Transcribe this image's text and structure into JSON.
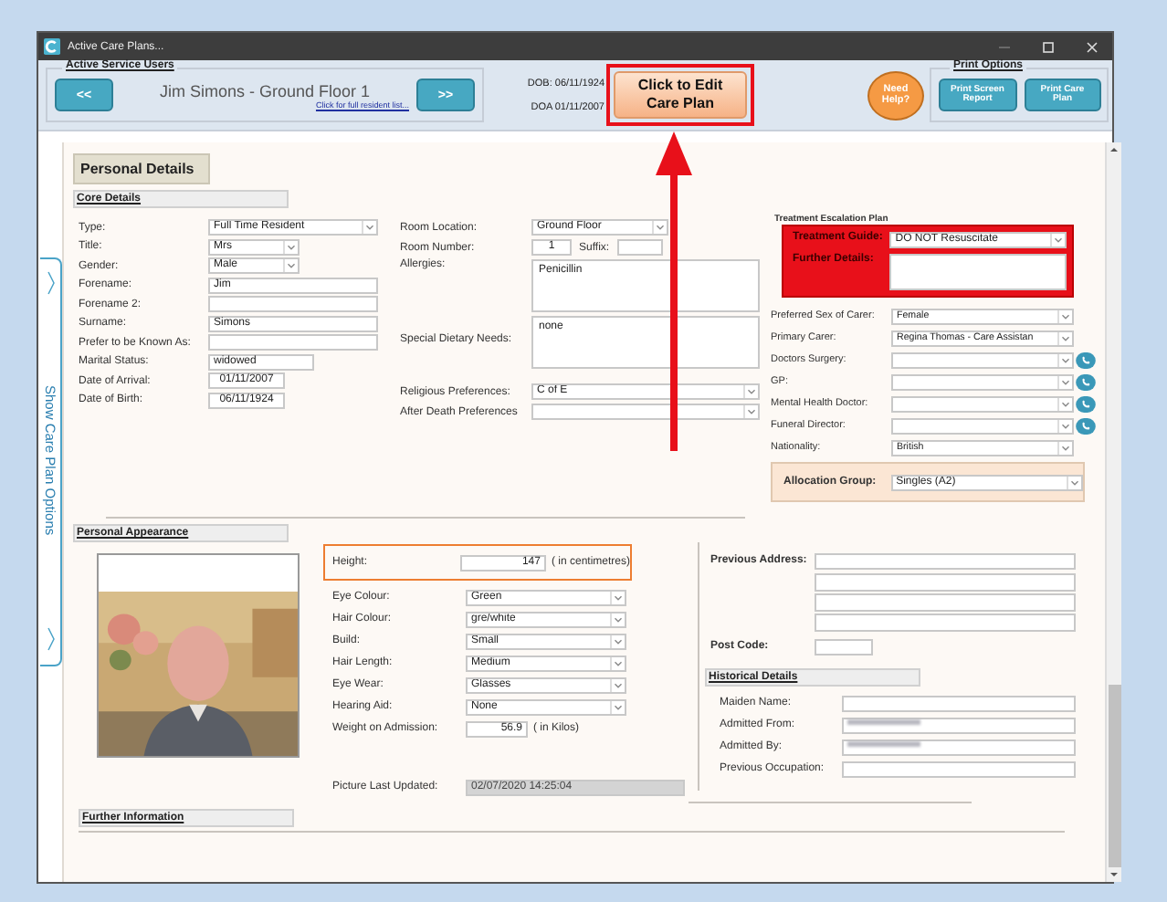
{
  "window": {
    "title": "Active Care Plans..."
  },
  "header": {
    "group_label": "Active Service Users",
    "prev_button": "<<",
    "resident_name": "Jim Simons - Ground Floor 1",
    "resident_list_link": "Click for full resident list...",
    "next_button": ">>",
    "dob": "DOB: 06/11/1924",
    "doa": "DOA 01/11/2007",
    "edit_button": "Click to Edit Care Plan",
    "help_button": "Need Help?",
    "print_group_label": "Print Options",
    "print_buttons": [
      "Print Screen Report",
      "Print Care Plan"
    ]
  },
  "side_tab": {
    "label": "Show Care Plan Options"
  },
  "page_tab": "Personal Details",
  "core_details": {
    "heading": "Core Details",
    "left_fields": [
      {
        "label": "Type:",
        "value": "Full Time Resident",
        "kind": "select"
      },
      {
        "label": "Title:",
        "value": "Mrs",
        "kind": "select"
      },
      {
        "label": "Gender:",
        "value": "Male",
        "kind": "select"
      },
      {
        "label": "Forename:",
        "value": "Jim",
        "kind": "text"
      },
      {
        "label": "Forename 2:",
        "kind": "text"
      },
      {
        "label": "Surname:",
        "value": "Simons",
        "kind": "text"
      },
      {
        "label": "Prefer to be Known As:",
        "kind": "text"
      },
      {
        "label": "Marital Status:",
        "value": "widowed",
        "kind": "text"
      },
      {
        "label": "Date of Arrival:",
        "value": "01/11/2007",
        "kind": "date"
      },
      {
        "label": "Date of Birth:",
        "value": "06/11/1924",
        "kind": "date"
      }
    ],
    "room_location": {
      "label": "Room Location:",
      "value": "Ground Floor"
    },
    "room_number": {
      "label": "Room Number:",
      "value": "1",
      "suffix_label": "Suffix:"
    },
    "allergies": {
      "label": "Allergies:",
      "value": "Penicillin"
    },
    "dietary": {
      "label": "Special Dietary Needs:",
      "value": "none"
    },
    "religious": {
      "label": "Religious Preferences:",
      "value": "C of E"
    },
    "after_death": {
      "label": "After Death Preferences"
    }
  },
  "treatment": {
    "heading": "Treatment Escalation Plan",
    "guide_label": "Treatment Guide:",
    "guide_value": "DO NOT Resuscitate",
    "details_label": "Further Details:"
  },
  "contacts": [
    {
      "label": "Preferred Sex of Carer:",
      "value": "Female",
      "phone": false
    },
    {
      "label": "Primary Carer:",
      "value": "Regina Thomas - Care Assistan",
      "phone": false
    },
    {
      "label": "Doctors Surgery:",
      "phone": true
    },
    {
      "label": "GP:",
      "phone": true
    },
    {
      "label": "Mental Health Doctor:",
      "phone": true
    },
    {
      "label": "Funeral Director:",
      "phone": true
    },
    {
      "label": "Nationality:",
      "value": "British",
      "phone": false
    }
  ],
  "allocation": {
    "label": "Allocation Group:",
    "value": "Singles (A2)"
  },
  "appearance": {
    "heading": "Personal Appearance",
    "height": {
      "label": "Height:",
      "value": "147",
      "unit": "( in centimetres)"
    },
    "fields": [
      {
        "label": "Eye Colour:",
        "value": "Green"
      },
      {
        "label": "Hair Colour:",
        "value": "gre/white"
      },
      {
        "label": "Build:",
        "value": "Small"
      },
      {
        "label": "Hair Length:",
        "value": "Medium"
      },
      {
        "label": "Eye Wear:",
        "value": "Glasses"
      },
      {
        "label": "Hearing Aid:",
        "value": "None"
      }
    ],
    "weight": {
      "label": "Weight on Admission:",
      "value": "56.9",
      "unit": "( in Kilos)"
    },
    "picture_updated": {
      "label": "Picture Last Updated:",
      "value": "02/07/2020 14:25:04"
    }
  },
  "address": {
    "label": "Previous Address:",
    "post_code_label": "Post Code:"
  },
  "historical": {
    "heading": "Historical Details",
    "fields": [
      {
        "label": "Maiden Name:",
        "redacted": false
      },
      {
        "label": "Admitted From:",
        "redacted": true
      },
      {
        "label": "Admitted By:",
        "redacted": true
      },
      {
        "label": "Previous Occupation:",
        "redacted": false
      }
    ]
  },
  "further_information": {
    "heading": "Further Information"
  }
}
